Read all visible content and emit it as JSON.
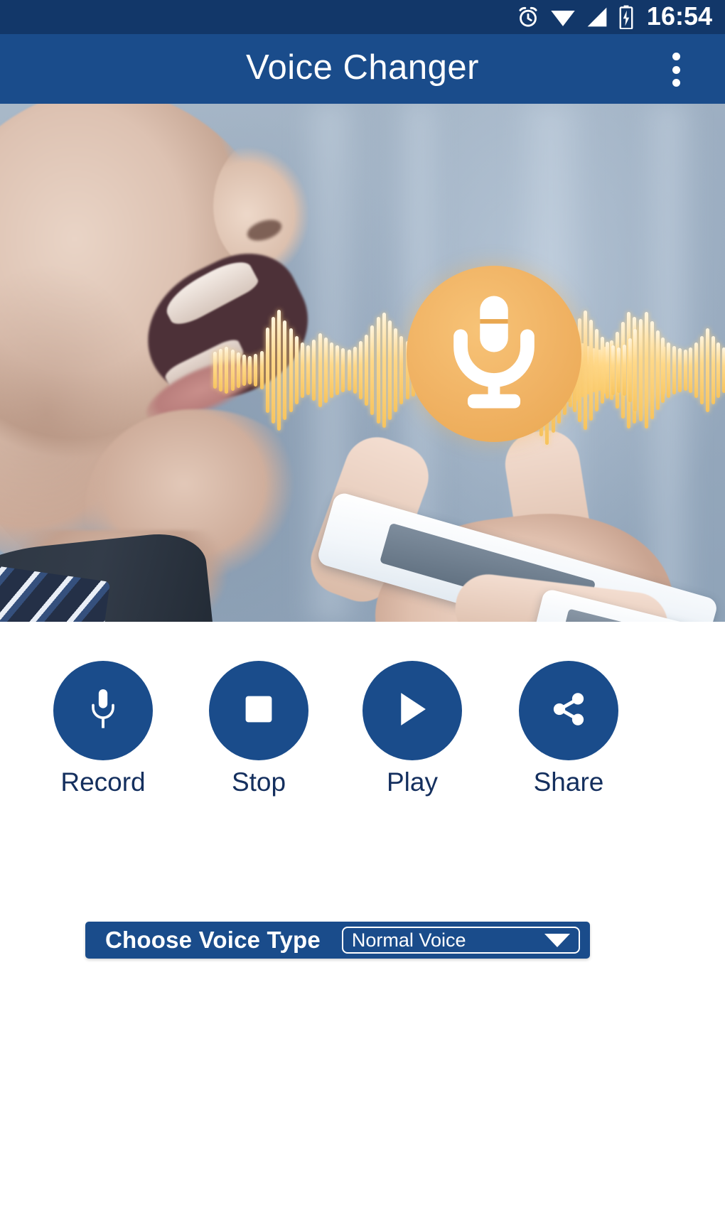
{
  "status_bar": {
    "time": "16:54",
    "icons": [
      "alarm-clock-icon",
      "wifi-icon",
      "signal-bars-icon",
      "battery-charging-icon"
    ]
  },
  "app_bar": {
    "title": "Voice Changer",
    "overflow_menu": "more-options"
  },
  "hero": {
    "alt": "Man speaking into a smartphone with sound waveform and orange microphone badge",
    "badge_icon": "microphone-icon",
    "badge_color": "#f0b263",
    "waveform_color": "#ffd98a"
  },
  "controls": [
    {
      "id": "record",
      "label": "Record",
      "icon": "microphone-icon"
    },
    {
      "id": "stop",
      "label": "Stop",
      "icon": "stop-square-icon"
    },
    {
      "id": "play",
      "label": "Play",
      "icon": "play-triangle-icon"
    },
    {
      "id": "share",
      "label": "Share",
      "icon": "share-nodes-icon"
    }
  ],
  "voice_type": {
    "label": "Choose Voice Type",
    "selected": "Normal Voice",
    "caret_icon": "chevron-down-icon"
  },
  "colors": {
    "status_bar": "#123769",
    "app_bar": "#1a4c8b",
    "button": "#1a4c8b",
    "label_text": "#142f5e",
    "accent_orange": "#f0b263",
    "background": "#ffffff"
  }
}
